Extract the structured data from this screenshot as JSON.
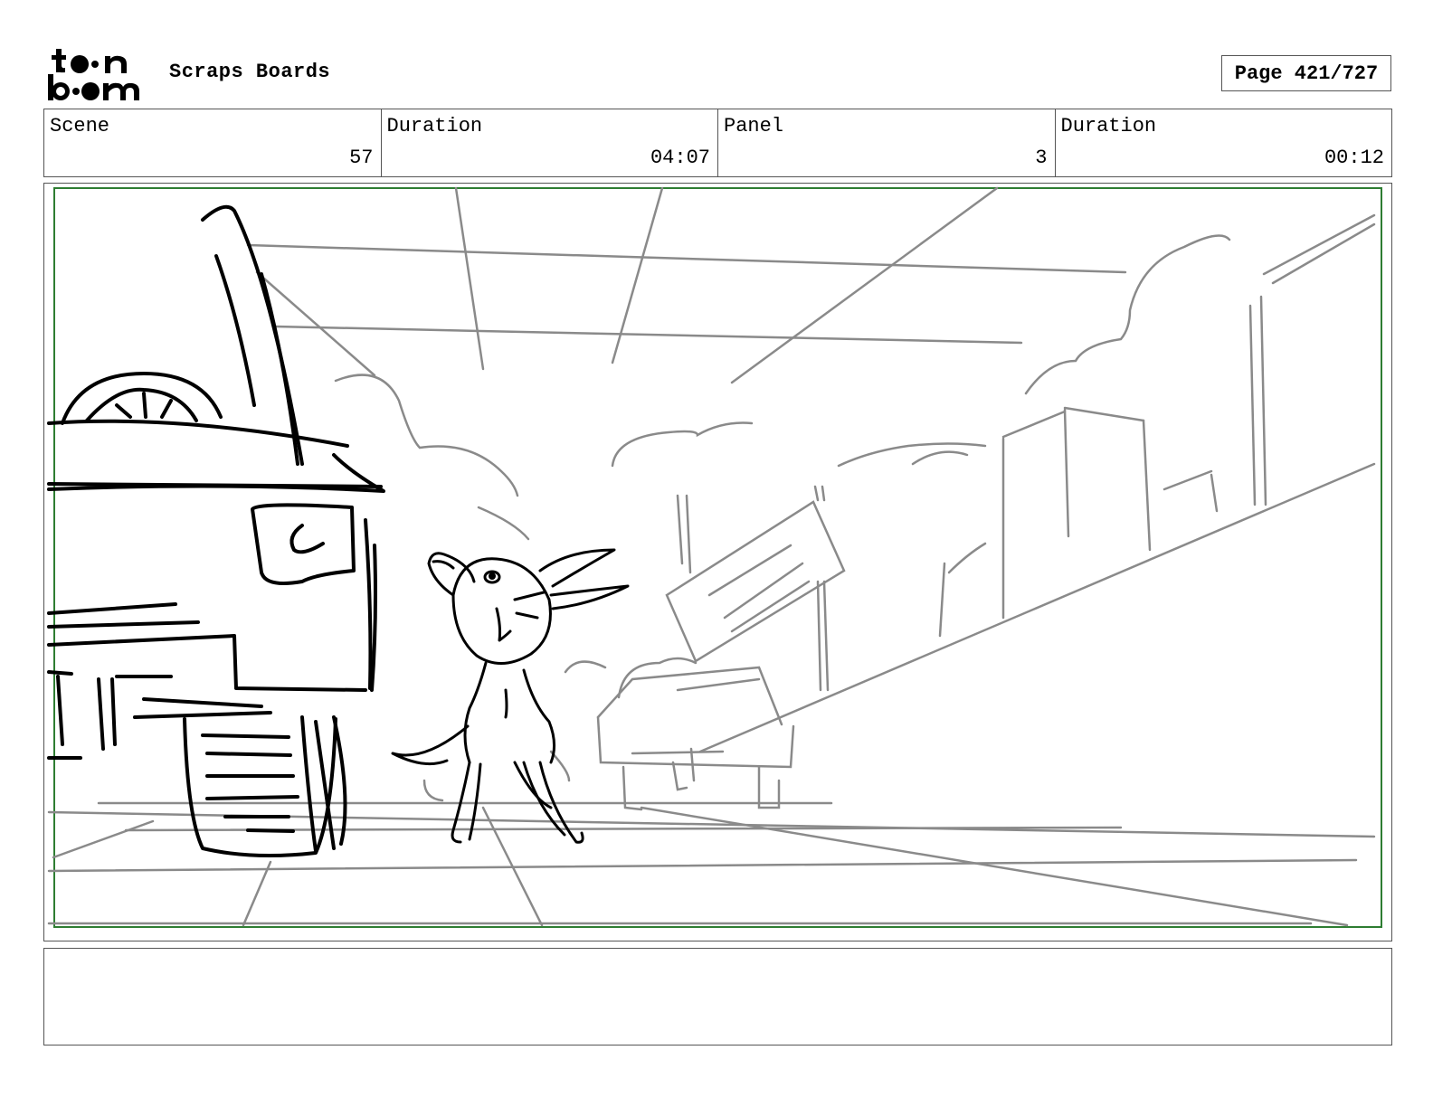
{
  "header": {
    "logo_text_top": "toon",
    "logo_text_bottom": "boom",
    "project_title": "Scraps Boards",
    "page_label": "Page 421/727"
  },
  "info": {
    "scene_label": "Scene",
    "scene_value": "57",
    "scene_duration_label": "Duration",
    "scene_duration_value": "04:07",
    "panel_label": "Panel",
    "panel_value": "3",
    "panel_duration_label": "Duration",
    "panel_duration_value": "00:12"
  },
  "panel": {
    "safe_frame_color": "#2e7d32"
  },
  "notes": {
    "text": ""
  }
}
